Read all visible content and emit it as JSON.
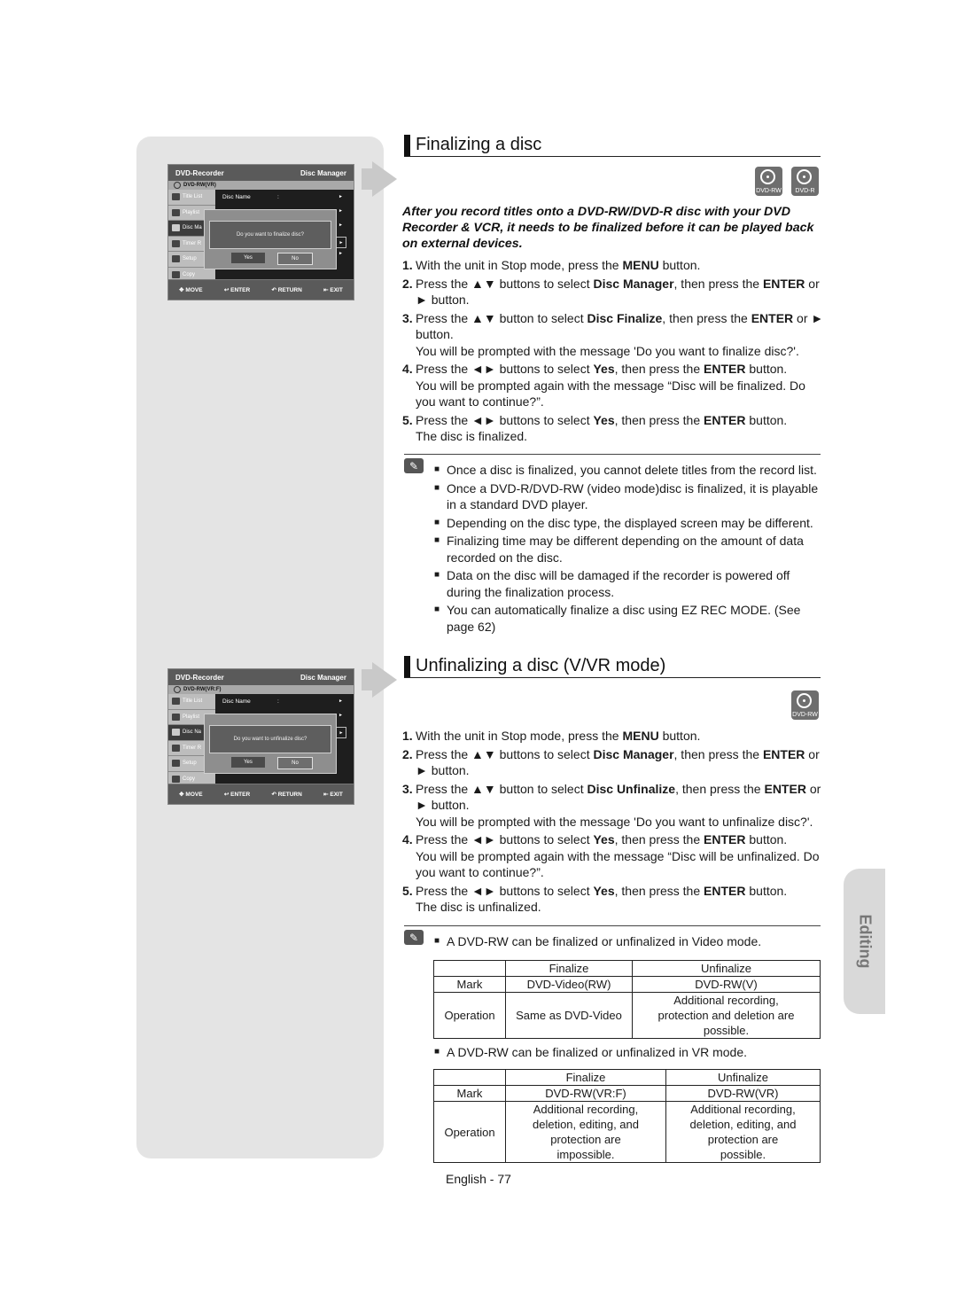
{
  "sections": [
    {
      "title": "Finalizing a disc",
      "disc_badges": [
        "DVD-RW",
        "DVD-R"
      ],
      "intro": "After you record titles onto a DVD-RW/DVD-R disc with your DVD Recorder & VCR, it needs to be finalized before it can be played back on external devices.",
      "steps": [
        {
          "num": "1.",
          "parts": [
            [
              "With the unit in Stop mode, press the ",
              false
            ],
            [
              "MENU",
              true
            ],
            [
              " button.",
              false
            ]
          ]
        },
        {
          "num": "2.",
          "parts": [
            [
              "Press the ▲▼ buttons to select ",
              false
            ],
            [
              "Disc Manager",
              true
            ],
            [
              ", then press the ",
              false
            ],
            [
              "ENTER",
              true
            ],
            [
              " or ► button.",
              false
            ]
          ]
        },
        {
          "num": "3.",
          "parts": [
            [
              "Press the ▲▼ button to select ",
              false
            ],
            [
              "Disc Finalize",
              true
            ],
            [
              ", then press the ",
              false
            ],
            [
              "ENTER",
              true
            ],
            [
              " or ► button.",
              false
            ]
          ],
          "extra": "You will be prompted with the message 'Do you want to finalize disc?'."
        },
        {
          "num": "4.",
          "parts": [
            [
              "Press the ◄► buttons to select ",
              false
            ],
            [
              "Yes",
              true
            ],
            [
              ", then press the ",
              false
            ],
            [
              "ENTER",
              true
            ],
            [
              " button.",
              false
            ]
          ],
          "extra": "You will be prompted again with the message “Disc will be finalized. Do you want to continue?”."
        },
        {
          "num": "5.",
          "parts": [
            [
              "Press the ◄► buttons to select ",
              false
            ],
            [
              "Yes",
              true
            ],
            [
              ", then press the ",
              false
            ],
            [
              "ENTER",
              true
            ],
            [
              " button.",
              false
            ]
          ],
          "extra": "The disc is finalized."
        }
      ],
      "notes": [
        "Once a disc is finalized, you cannot delete titles from the record list.",
        "Once a DVD-R/DVD-RW (video mode)disc is finalized, it is playable in a standard DVD player.",
        "Depending on the disc type, the displayed screen may be different.",
        "Finalizing time may be different depending on the amount of data recorded on the disc.",
        "Data on the disc will be damaged if the recorder is powered off during the finalization process.",
        "You can automatically finalize a disc using EZ REC MODE. (See page 62)"
      ]
    },
    {
      "title": "Unfinalizing a disc (V/VR mode)",
      "disc_badges": [
        "DVD-RW"
      ],
      "steps": [
        {
          "num": "1.",
          "parts": [
            [
              "With the unit in Stop mode, press the ",
              false
            ],
            [
              "MENU",
              true
            ],
            [
              " button.",
              false
            ]
          ]
        },
        {
          "num": "2.",
          "parts": [
            [
              "Press the ▲▼ buttons to select ",
              false
            ],
            [
              "Disc Manager",
              true
            ],
            [
              ", then press the ",
              false
            ],
            [
              "ENTER",
              true
            ],
            [
              " or ► button.",
              false
            ]
          ]
        },
        {
          "num": "3.",
          "parts": [
            [
              "Press the ▲▼ button to select ",
              false
            ],
            [
              "Disc Unfinalize",
              true
            ],
            [
              ", then press the ",
              false
            ],
            [
              "ENTER",
              true
            ],
            [
              " or ► button.",
              false
            ]
          ],
          "extra": "You will be prompted with the message 'Do you want to unfinalize disc?'."
        },
        {
          "num": "4.",
          "parts": [
            [
              "Press the ◄► buttons to select ",
              false
            ],
            [
              "Yes",
              true
            ],
            [
              ", then press the ",
              false
            ],
            [
              "ENTER",
              true
            ],
            [
              " button.",
              false
            ]
          ],
          "extra": "You will be prompted again with the message “Disc will be unfinalized. Do you want to continue?”."
        },
        {
          "num": "5.",
          "parts": [
            [
              "Press the ◄► buttons to select ",
              false
            ],
            [
              "Yes",
              true
            ],
            [
              ", then press the ENTER",
              false
            ],
            [
              "",
              true
            ],
            [
              " button.",
              false
            ]
          ],
          "extra": "The disc is unfinalized."
        }
      ],
      "note_video": "A DVD-RW can be finalized or unfinalized in Video mode.",
      "table_video": {
        "header": [
          "",
          "Finalize",
          "Unfinalize"
        ],
        "rows": [
          [
            "Mark",
            "DVD-Video(RW)",
            "DVD-RW(V)"
          ],
          [
            "Operation",
            "Same as DVD-Video",
            "Additional recording, protection and deletion are possible."
          ]
        ]
      },
      "note_vr": "A DVD-RW can be finalized or unfinalized in VR mode.",
      "table_vr": {
        "header": [
          "",
          "Finalize",
          "Unfinalize"
        ],
        "rows": [
          [
            "Mark",
            "DVD-RW(VR:F)",
            "DVD-RW(VR)"
          ],
          [
            "Operation",
            "Additional recording, deletion, editing, and protection are impossible.",
            "Additional recording, deletion, editing, and protection are possible."
          ]
        ]
      }
    }
  ],
  "osd_screens": [
    {
      "header_left": "DVD-Recorder",
      "header_right": "Disc Manager",
      "disc_type": "DVD-RW(VR)",
      "menu": [
        "Title List",
        "Playlist",
        "Disc Ma",
        "Timer R",
        "Setup",
        "Copy"
      ],
      "selected_menu": 2,
      "row_label": "Disc Name",
      "row_colon": ":",
      "dialog_message": "Do you want to finalize disc?",
      "yes": "Yes",
      "no": "No",
      "footer": [
        "MOVE",
        "ENTER",
        "RETURN",
        "EXIT"
      ]
    },
    {
      "header_left": "DVD-Recorder",
      "header_right": "Disc Manager",
      "disc_type": "DVD-RW(VR:F)",
      "menu": [
        "Title List",
        "Playlist",
        "Disc Na",
        "Timer R",
        "Setup",
        "Copy"
      ],
      "selected_menu": 2,
      "row_label": "Disc Name",
      "row_colon": ":",
      "dialog_message": "Do you want to unfinalize disc?",
      "yes": "Yes",
      "no": "No",
      "footer": [
        "MOVE",
        "ENTER",
        "RETURN",
        "EXIT"
      ]
    }
  ],
  "side_tab": "Editing",
  "page_number": "English - 77"
}
